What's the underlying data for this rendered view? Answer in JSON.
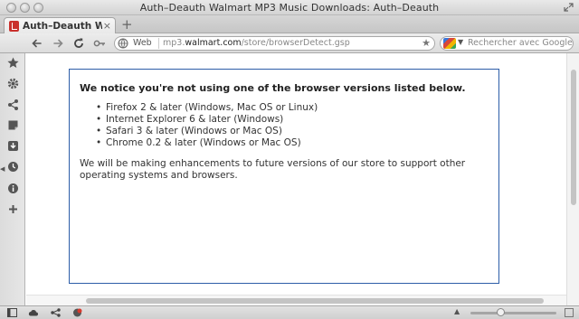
{
  "window": {
    "title": "Auth–Deauth Walmart MP3 Music Downloads: Auth–Deauth"
  },
  "tab": {
    "title": "Auth–Deauth Walmar...",
    "close": "×"
  },
  "new_tab": "+",
  "addressbar": {
    "site_label": "Web",
    "url_prefix": "mp3.",
    "url_host": "walmart.com",
    "url_path": "/store/browserDetect.gsp"
  },
  "search": {
    "placeholder": "Rechercher avec Google"
  },
  "notice": {
    "title": "We notice you're not using one of the browser versions listed below.",
    "browsers": [
      "Firefox 2 & later (Windows, Mac OS or Linux)",
      "Internet Explorer 6 & later (Windows)",
      "Safari 3 & later (Windows or Mac OS)",
      "Chrome 0.2 & later (Windows or Mac OS)"
    ],
    "message": "We will be making enhancements to future versions of our store to support other operating systems and browsers."
  },
  "sidebar": {
    "icons": [
      "star-icon",
      "gear-icon",
      "share-icon",
      "note-icon",
      "download-icon",
      "history-icon",
      "info-icon",
      "plus-icon"
    ]
  },
  "statusbar": {
    "icons": [
      "panel-toggle-icon",
      "cloud-icon",
      "share-icon",
      "alert-icon"
    ]
  },
  "colors": {
    "notice_border": "#2c5da8",
    "favicon": "#c9302c"
  }
}
